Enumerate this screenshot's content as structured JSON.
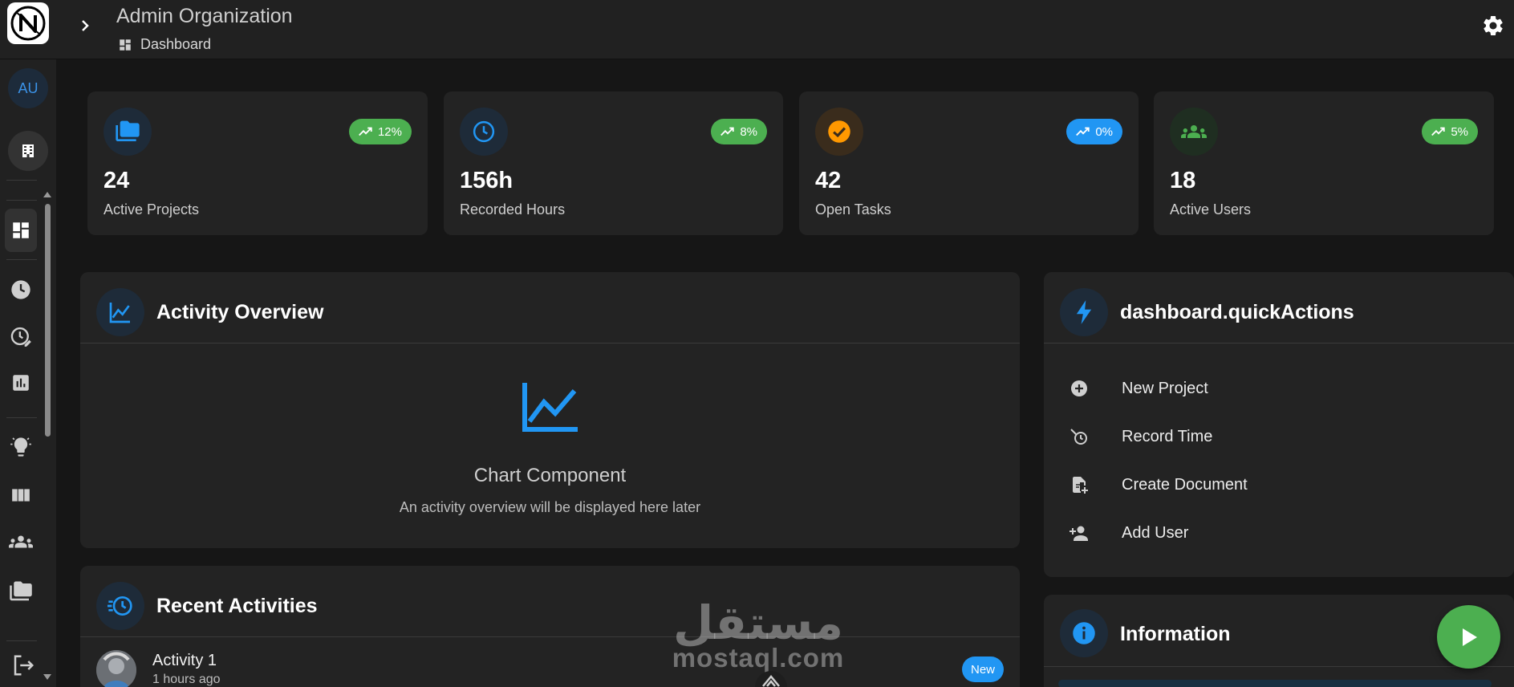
{
  "header": {
    "org_title": "Admin Organization",
    "breadcrumb": "Dashboard"
  },
  "sidebar": {
    "avatar_initials": "AU",
    "items": [
      {
        "icon": "dashboard-icon",
        "active": true
      },
      {
        "icon": "clock-icon"
      },
      {
        "icon": "time-edit-icon"
      },
      {
        "icon": "bar-chart-icon"
      },
      {
        "icon": "lightbulb-icon"
      },
      {
        "icon": "columns-icon"
      },
      {
        "icon": "people-icon"
      },
      {
        "icon": "folders-icon"
      }
    ]
  },
  "stats": [
    {
      "value": "24",
      "label": "Active Projects",
      "trend": "12%",
      "icon": "folder-icon",
      "badge_color": "#4caf50",
      "icon_color": "#2196f3"
    },
    {
      "value": "156h",
      "label": "Recorded Hours",
      "trend": "8%",
      "icon": "clock-icon",
      "badge_color": "#4caf50",
      "icon_color": "#2196f3"
    },
    {
      "value": "42",
      "label": "Open Tasks",
      "trend": "0%",
      "icon": "check-circle-icon",
      "badge_color": "#2196f3",
      "icon_color": "#ff9800"
    },
    {
      "value": "18",
      "label": "Active Users",
      "trend": "5%",
      "icon": "people-icon",
      "badge_color": "#4caf50",
      "icon_color": "#4caf50"
    }
  ],
  "activity_overview": {
    "title": "Activity Overview",
    "placeholder_title": "Chart Component",
    "placeholder_desc": "An activity overview will be displayed here later"
  },
  "quick_actions": {
    "title": "dashboard.quickActions",
    "items": [
      {
        "label": "New Project",
        "icon": "add-circle-icon"
      },
      {
        "label": "Record Time",
        "icon": "timer-icon"
      },
      {
        "label": "Create Document",
        "icon": "document-add-icon"
      },
      {
        "label": "Add User",
        "icon": "person-add-icon"
      }
    ]
  },
  "recent_activities": {
    "title": "Recent Activities",
    "items": [
      {
        "title": "Activity 1",
        "time": "1 hours ago",
        "badge": "New"
      }
    ]
  },
  "information": {
    "title": "Information"
  },
  "watermark": {
    "arabic": "مستقل",
    "latin": "mostaql.com"
  },
  "colors": {
    "accent": "#2196f3",
    "success": "#4caf50",
    "warning": "#ff9800",
    "card_bg": "#232323",
    "page_bg": "#161616"
  }
}
